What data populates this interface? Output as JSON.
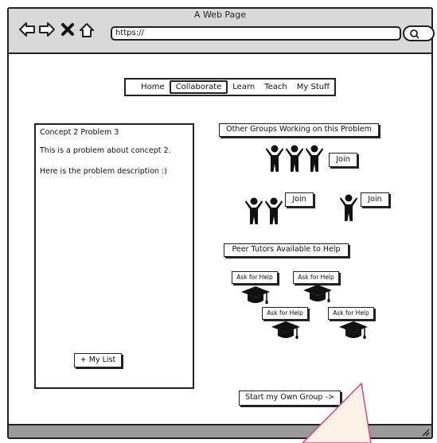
{
  "window": {
    "title": "A Web Page",
    "url": "https://"
  },
  "menu": {
    "items": [
      {
        "label": "Home",
        "active": false
      },
      {
        "label": "Collaborate",
        "active": true
      },
      {
        "label": "Learn",
        "active": false
      },
      {
        "label": "Teach",
        "active": false
      },
      {
        "label": "My Stuff",
        "active": false
      }
    ]
  },
  "problem": {
    "title": "Concept 2 Problem 3",
    "line1": "This is a problem about concept 2.",
    "line2": "Here is the problem description :)",
    "add_button": "+ My List"
  },
  "groups": {
    "heading": "Other Groups Working on this Problem",
    "join_labels": [
      "Join",
      "Join",
      "Join"
    ]
  },
  "tutors": {
    "heading": "Peer Tutors Available to Help",
    "ask_labels": [
      "Ask for Help",
      "Ask for Help",
      "Ask for Help",
      "Ask for Help"
    ]
  },
  "own_group_button": "Start my Own Group ->"
}
